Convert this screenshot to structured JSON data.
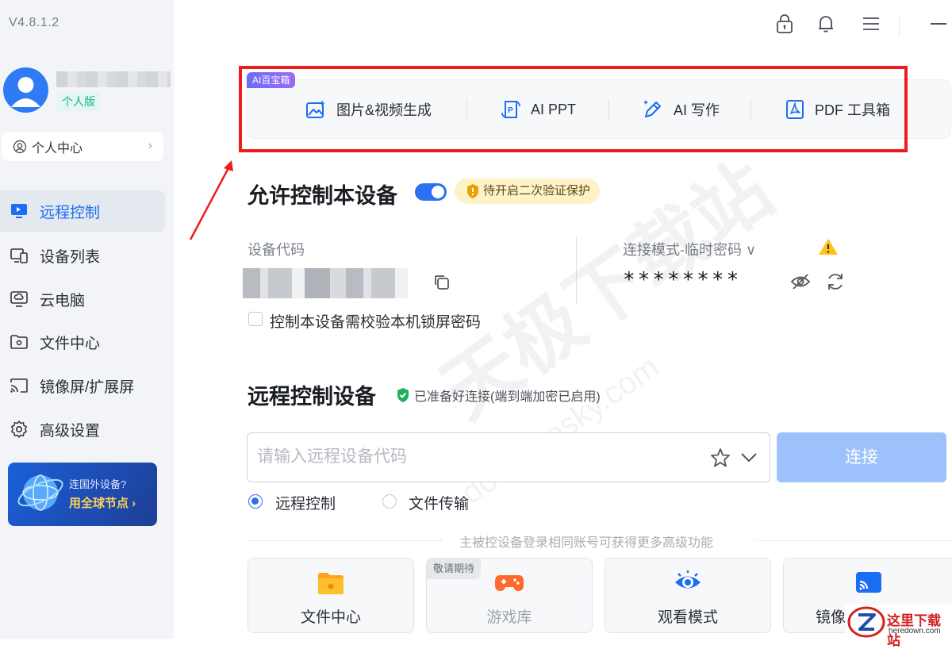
{
  "app": {
    "version": "V4.8.1.2"
  },
  "user": {
    "edition": "个人版",
    "personal_center": "个人中心"
  },
  "sidebar": {
    "items": [
      {
        "label": "远程控制",
        "active": true,
        "icon": "monitor-icon"
      },
      {
        "label": "设备列表",
        "icon": "device-list-icon"
      },
      {
        "label": "云电脑",
        "icon": "cloud-pc-icon"
      },
      {
        "label": "文件中心",
        "icon": "folder-icon"
      },
      {
        "label": "镜像屏/扩展屏",
        "icon": "cast-icon"
      },
      {
        "label": "高级设置",
        "icon": "gear-icon"
      }
    ],
    "promo": {
      "line1": "连国外设备?",
      "line2": "用全球节点 ›"
    }
  },
  "toolbox": {
    "tag": "AI百宝箱",
    "tools": [
      {
        "label": "图片&视频生成",
        "icon": "image-ai-icon"
      },
      {
        "label": "AI PPT",
        "icon": "ppt-icon"
      },
      {
        "label": "AI 写作",
        "icon": "pen-icon"
      },
      {
        "label": "PDF 工具箱",
        "icon": "pdf-icon"
      }
    ]
  },
  "allow": {
    "title": "允许控制本设备",
    "enabled": true,
    "warning": "待开启二次验证保护",
    "code_label": "设备代码",
    "mode_label": "连接模式-临时密码 ∨",
    "password": "********",
    "lock_check_label": "控制本设备需校验本机锁屏密码"
  },
  "remote": {
    "title": "远程控制设备",
    "status": "已准备好连接(端到端加密已启用)",
    "input_placeholder": "请输入远程设备代码",
    "connect_label": "连接",
    "modes": [
      {
        "label": "远程控制",
        "selected": true
      },
      {
        "label": "文件传输",
        "selected": false
      }
    ],
    "hint": "主被控设备登录相同账号可获得更多高级功能",
    "cards": [
      {
        "label": "文件中心",
        "icon": "folder-icon"
      },
      {
        "label": "游戏库",
        "icon": "gamepad-icon",
        "badge": "敬请期待",
        "disabled": true
      },
      {
        "label": "观看模式",
        "icon": "eye-icon"
      },
      {
        "label": "镜像",
        "icon": "cast-icon"
      }
    ]
  },
  "watermark": {
    "line1": "天极下载站",
    "line2": "down.yesky.com"
  },
  "corner_logo": {
    "name": "这里下载站",
    "url": "heredown.com"
  },
  "colors": {
    "accent": "#2f6ff2",
    "highlight": "#ee1c1c",
    "edition": "#17b486"
  }
}
